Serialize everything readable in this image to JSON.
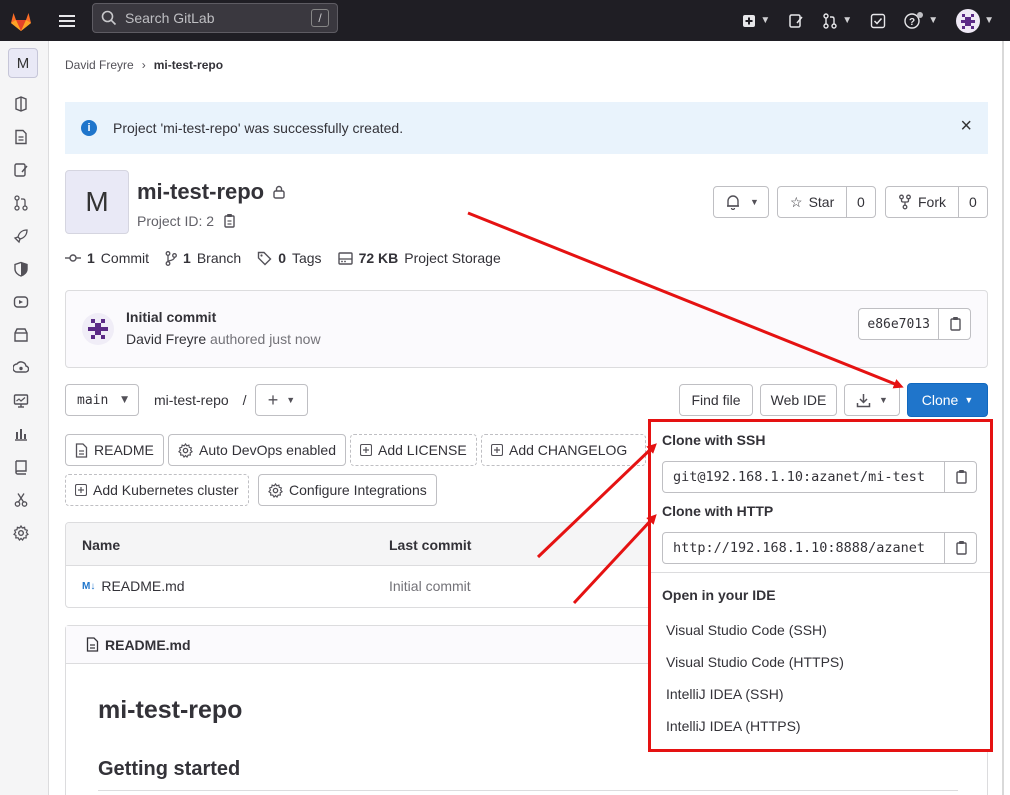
{
  "topbar": {
    "search_placeholder": "Search GitLab",
    "search_shortcut": "/"
  },
  "sidebar": {
    "project_initial": "M",
    "items": [
      "project-info-icon",
      "repository-icon",
      "issues-icon",
      "merge-requests-icon",
      "ci-cd-icon",
      "security-icon",
      "deployments-icon",
      "packages-icon",
      "infrastructure-icon",
      "monitor-icon",
      "analytics-icon",
      "wiki-icon",
      "snippets-icon",
      "settings-icon"
    ]
  },
  "breadcrumb": {
    "owner": "David Freyre",
    "project": "mi-test-repo"
  },
  "alert": {
    "message": "Project 'mi-test-repo' was successfully created.",
    "close": "×"
  },
  "project": {
    "initial": "M",
    "name": "mi-test-repo",
    "id_label": "Project ID: 2",
    "star_label": "Star",
    "star_count": "0",
    "fork_label": "Fork",
    "fork_count": "0"
  },
  "stats": {
    "commits_count": "1",
    "commits_label": "Commit",
    "branches_count": "1",
    "branches_label": "Branch",
    "tags_count": "0",
    "tags_label": "Tags",
    "storage_size": "72 KB",
    "storage_label": "Project Storage"
  },
  "last_commit": {
    "title": "Initial commit",
    "author": "David Freyre",
    "meta": "authored just now",
    "sha": "e86e7013"
  },
  "repo_toolbar": {
    "branch": "main",
    "path": "mi-test-repo",
    "path_sep": "/",
    "find_file": "Find file",
    "web_ide": "Web IDE",
    "clone": "Clone"
  },
  "shortcuts": {
    "readme": "README",
    "auto_devops": "Auto DevOps enabled",
    "add_license": "Add LICENSE",
    "add_changelog": "Add CHANGELOG",
    "add_k8s": "Add Kubernetes cluster",
    "configure_integrations": "Configure Integrations"
  },
  "file_table": {
    "col_name": "Name",
    "col_last_commit": "Last commit",
    "rows": [
      {
        "name": "README.md",
        "commit": "Initial commit",
        "icon": "M↓"
      }
    ]
  },
  "readme": {
    "filename": "README.md",
    "h1": "mi-test-repo",
    "h2": "Getting started"
  },
  "clone_dropdown": {
    "ssh_label": "Clone with SSH",
    "ssh_url": "git@192.168.1.10:azanet/mi-test",
    "http_label": "Clone with HTTP",
    "http_url": "http://192.168.1.10:8888/azanet",
    "ide_label": "Open in your IDE",
    "ide_options": [
      "Visual Studio Code (SSH)",
      "Visual Studio Code (HTTPS)",
      "IntelliJ IDEA (SSH)",
      "IntelliJ IDEA (HTTPS)"
    ]
  },
  "colors": {
    "topbar": "#1f1e24",
    "primary": "#1f75cb",
    "annotation": "#e51212",
    "alert_bg": "#e9f3fc"
  }
}
